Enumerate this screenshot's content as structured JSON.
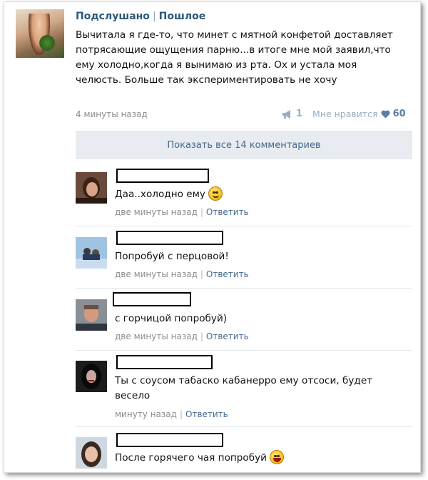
{
  "post": {
    "group_name": "Подслушано",
    "separator": "|",
    "group_category": "Пошлое",
    "text": "Вычитала я где-то, что минет с мятной конфетой доставляет потрясающие ощущения парню...в итоге мне мой заявил,что ему холодно,когда я вынимаю из рта. Ох и устала моя челюсть. Больше так экспериментировать не хочу",
    "time": "4 минуты назад",
    "share_count": "1",
    "like_label": "Мне нравится",
    "like_count": "60",
    "share_icon": "megaphone-icon",
    "like_icon": "heart-icon"
  },
  "show_all_label": "Показать все 14 комментариев",
  "comments": [
    {
      "text": "Даа..холодно ему",
      "emoji": "smiling-face-emoji",
      "time": "две минуты назад",
      "sep": "|",
      "reply": "Ответить"
    },
    {
      "text": "Попробуй с перцовой!",
      "time": "две минуты назад",
      "sep": "|",
      "reply": "Ответить"
    },
    {
      "text": "с горчицой попробуй)",
      "time": "две минуты назад",
      "sep": "|",
      "reply": "Ответить"
    },
    {
      "text": "Ты с соусом табаско кабанерро ему отсоси, будет весело",
      "time": "минуту назад",
      "sep": "|",
      "reply": "Ответить"
    },
    {
      "text": "После горячего чая попробуй",
      "emoji": "laughing-face-emoji"
    }
  ],
  "colors": {
    "link": "#2b587a",
    "reply": "#45688e",
    "muted": "#8c8c8c",
    "show_all_bg": "#e8ecf0"
  }
}
